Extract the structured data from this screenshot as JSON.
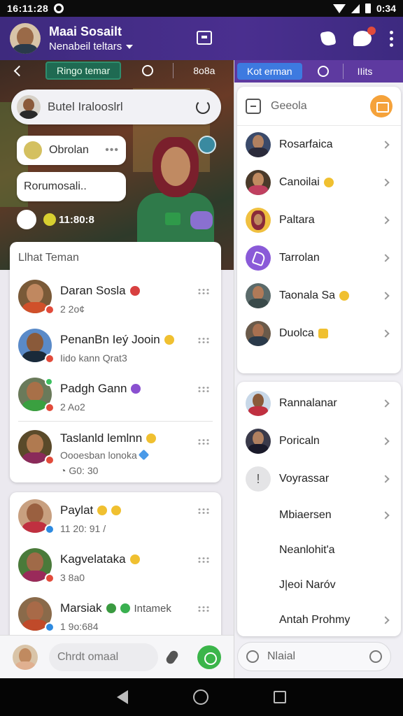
{
  "status_bar": {
    "time": "16:11:28",
    "clock_right": "0:34"
  },
  "app_bar": {
    "title": "Maai Sosailt",
    "subtitle": "Nenabeil teltars"
  },
  "left_nav": {
    "tab_green": "Ringo temar",
    "tab_text": "8o8a"
  },
  "search_bubble": {
    "text": "Butel Iralooslrl"
  },
  "bubbles": {
    "chat_label": "Obrolan",
    "more": "•••",
    "message": "Rorumosali.."
  },
  "story_row": {
    "text": "11:80:8"
  },
  "friends_card": {
    "header": "Llhat Teman",
    "contacts": [
      {
        "name": "Daran Sosla",
        "sub": "2 2o¢"
      },
      {
        "name": "PenanBn Ieý Jooin",
        "sub": "Iido kann Qrat3"
      },
      {
        "name": "Padgh Gann",
        "sub": "2 Ao2"
      },
      {
        "name": "Taslanld lemlnn",
        "sub": "Oooesban lonoka",
        "sub2": "G0: 30"
      }
    ]
  },
  "friends_card_2": {
    "contacts": [
      {
        "name": "Paylat",
        "sub": "11 20: 91 /"
      },
      {
        "name": "Kagvelataka",
        "sub": "3 8a0"
      },
      {
        "name": "Marsiak",
        "status": "Intamek",
        "sub": "1 9o:684"
      }
    ]
  },
  "compose_left": {
    "placeholder": "Chrdt omaal"
  },
  "right_tabs": {
    "active": "Kot erman",
    "text": "IIits"
  },
  "right_search": {
    "label": "Geeola"
  },
  "right_menu_1": [
    {
      "label": "Rosarfaica"
    },
    {
      "label": "Canoilai"
    },
    {
      "label": "Paltara"
    },
    {
      "label": "Tarrolan"
    },
    {
      "label": "Taonala Sa"
    },
    {
      "label": "Duolca"
    }
  ],
  "right_menu_2": [
    {
      "label": "Rannalanar"
    },
    {
      "label": "Poricaln"
    },
    {
      "label": "Voyrassar",
      "icon": "!"
    },
    {
      "label": "Mbiaersen"
    },
    {
      "label": "Neanlohit'a"
    },
    {
      "label": "J|eoi Naróv"
    },
    {
      "label": "Antah Prohmy"
    }
  ],
  "compose_right": {
    "placeholder": "Nlaial"
  },
  "colors": {
    "appbar": "#3e2a7e",
    "accent_green": "#3bb54a",
    "accent_orange": "#f5a23a",
    "tab_blue": "#3d7ae0"
  }
}
